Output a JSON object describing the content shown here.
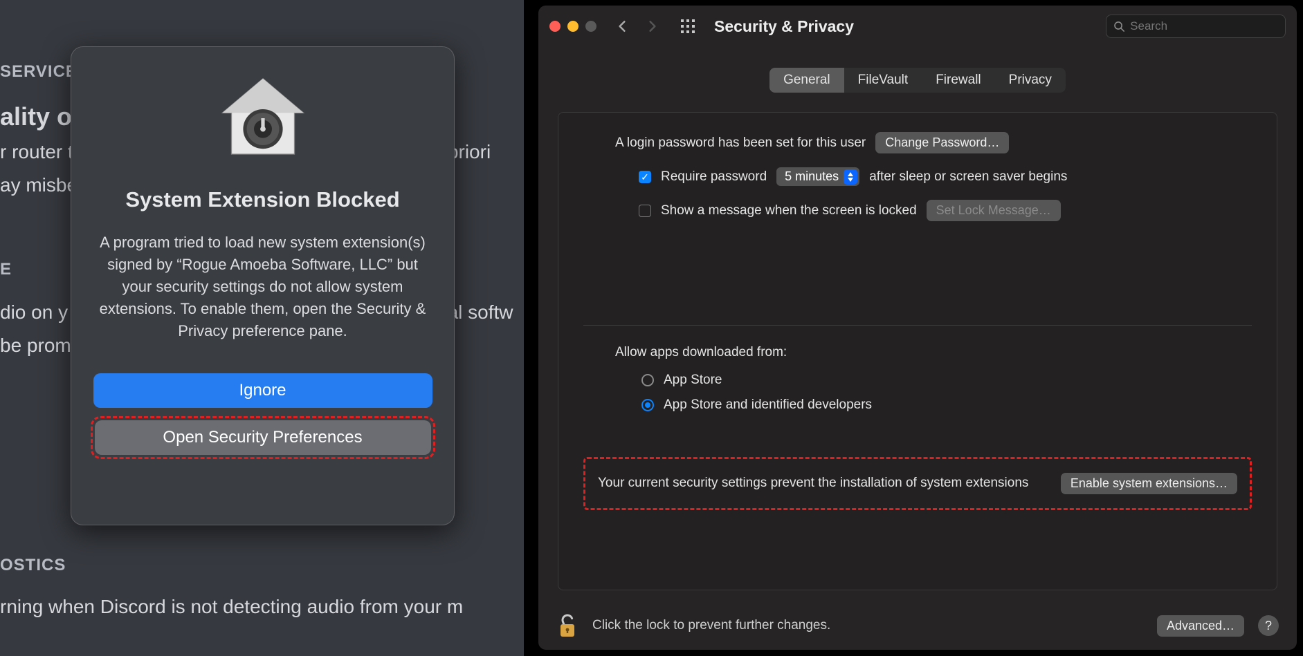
{
  "left": {
    "bg": {
      "heading_service": "SERVICE",
      "line_qos": "ality of S",
      "line_router1": "r router t",
      "line_router2": "ay misbe",
      "line_router_tail": "gh priori",
      "heading_e": "E",
      "line_audio1": "dio on y",
      "line_audio2": "be prom",
      "line_audio_tail": "nal softw",
      "heading_diag": "OSTICS",
      "line_discord": "rning when Discord is not detecting audio from your m"
    },
    "alert": {
      "title": "System Extension Blocked",
      "body": "A program tried to load new system extension(s) signed by “Rogue Amoeba Software, LLC” but your security settings do not allow system extensions. To enable them, open the Security & Privacy preference pane.",
      "ignore_label": "Ignore",
      "open_label": "Open Security Preferences"
    }
  },
  "right": {
    "window_title": "Security & Privacy",
    "search_placeholder": "Search",
    "tabs": {
      "general": "General",
      "filevault": "FileVault",
      "firewall": "Firewall",
      "privacy": "Privacy",
      "active": "general"
    },
    "login_text": "A login password has been set for this user",
    "change_pw_label": "Change Password…",
    "require_pw_label": "Require password",
    "require_pw_checked": true,
    "delay_value": "5 minutes",
    "after_text": "after sleep or screen saver begins",
    "show_msg_label": "Show a message when the screen is locked",
    "show_msg_checked": false,
    "set_lock_label": "Set Lock Message…",
    "allow_heading": "Allow apps downloaded from:",
    "radio1": "App Store",
    "radio2": "App Store and identified developers",
    "radio_selected": 2,
    "ext_text": "Your current security settings prevent the installation of system extensions",
    "enable_ext_label": "Enable system extensions…",
    "lock_text": "Click the lock to prevent further changes.",
    "advanced_label": "Advanced…",
    "help_label": "?"
  }
}
